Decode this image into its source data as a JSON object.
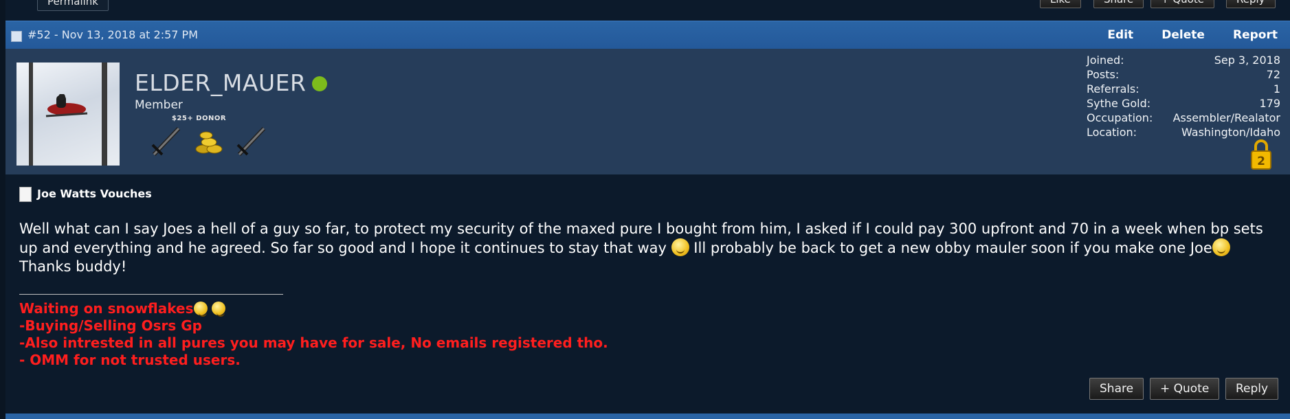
{
  "top": {
    "permalink_label": "Permalink",
    "buttons": [
      "Like",
      "Share",
      "+ Quote",
      "Reply"
    ]
  },
  "header": {
    "post_meta": "#52 - Nov 13, 2018 at 2:57 PM",
    "edit_label": "Edit",
    "delete_label": "Delete",
    "report_label": "Report"
  },
  "user": {
    "username": "ELDER_MAUER",
    "title": "Member",
    "badge_text": "$25+ DONOR",
    "online_status_color": "#7dbb1c",
    "stats": [
      {
        "label": "Joined:",
        "value": "Sep 3, 2018"
      },
      {
        "label": "Posts:",
        "value": "72"
      },
      {
        "label": "Referrals:",
        "value": "1"
      },
      {
        "label": "Sythe Gold:",
        "value": "179"
      },
      {
        "label": "Occupation:",
        "value": "Assembler/Realator"
      },
      {
        "label": "Location:",
        "value": "Washington/Idaho"
      }
    ],
    "lock_icon": "padlock-2-icon"
  },
  "post": {
    "title": "Joe Watts Vouches",
    "message_part1": "Well what can I say Joes a hell of a guy so far, to protect my security of the maxed pure I bought from him, I asked if I could pay 300 upfront and 70 in a week when bp sets up and everything and he agreed. So far so good and I hope it continues to stay that way ",
    "message_part2": " Ill probably be back to get a new obby mauler soon if you make one Joe",
    "message_part3": "Thanks buddy!"
  },
  "signature": {
    "line1": "Waiting on snowflakes",
    "line2": "-Buying/Selling Osrs Gp",
    "line3": "-Also intrested in all pures you may have for sale, No emails registered tho.",
    "line4": "- OMM for not trusted users.",
    "color": "#ff1e1e"
  },
  "footer": {
    "share_label": "Share",
    "quote_label": "+ Quote",
    "reply_label": "Reply"
  }
}
